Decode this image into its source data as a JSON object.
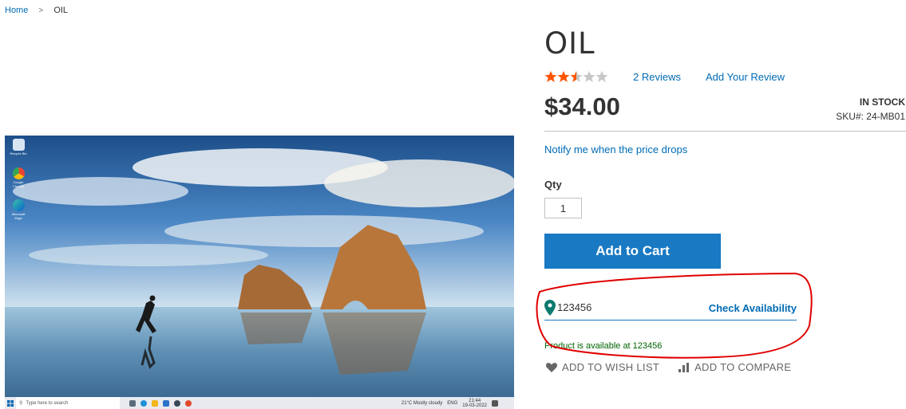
{
  "breadcrumb": {
    "home": "Home",
    "separator": ">",
    "current": "OIL"
  },
  "product": {
    "title": "OIL",
    "rating_stars": 2.5,
    "rating_max": 5,
    "reviews_link": "2  Reviews",
    "add_review_link": "Add Your Review",
    "price": "$34.00",
    "stock": "IN STOCK",
    "sku": "SKU#:  24-MB01",
    "notify_link": "Notify me when the price drops",
    "qty_label": "Qty",
    "qty_value": "1",
    "add_to_cart": "Add to Cart"
  },
  "availability": {
    "zip_value": "123456",
    "check_button": "Check Availability",
    "message": "Product is available at 123456"
  },
  "actions": {
    "wishlist": "ADD TO WISH LIST",
    "compare": "ADD TO COMPARE"
  },
  "image_desktop": {
    "search_placeholder": "Type here to search",
    "weather": "21°C  Mostly cloudy",
    "lang": "ENG",
    "clock_time": "21:44",
    "clock_date": "19-03-2022",
    "icons": [
      "Recycle Bin",
      "Google Chrome",
      "Microsoft Edge"
    ]
  },
  "colors": {
    "link": "#006bb4",
    "button": "#1979c3",
    "star": "#ff5501",
    "success": "#006400",
    "annotation": "#e00000"
  }
}
